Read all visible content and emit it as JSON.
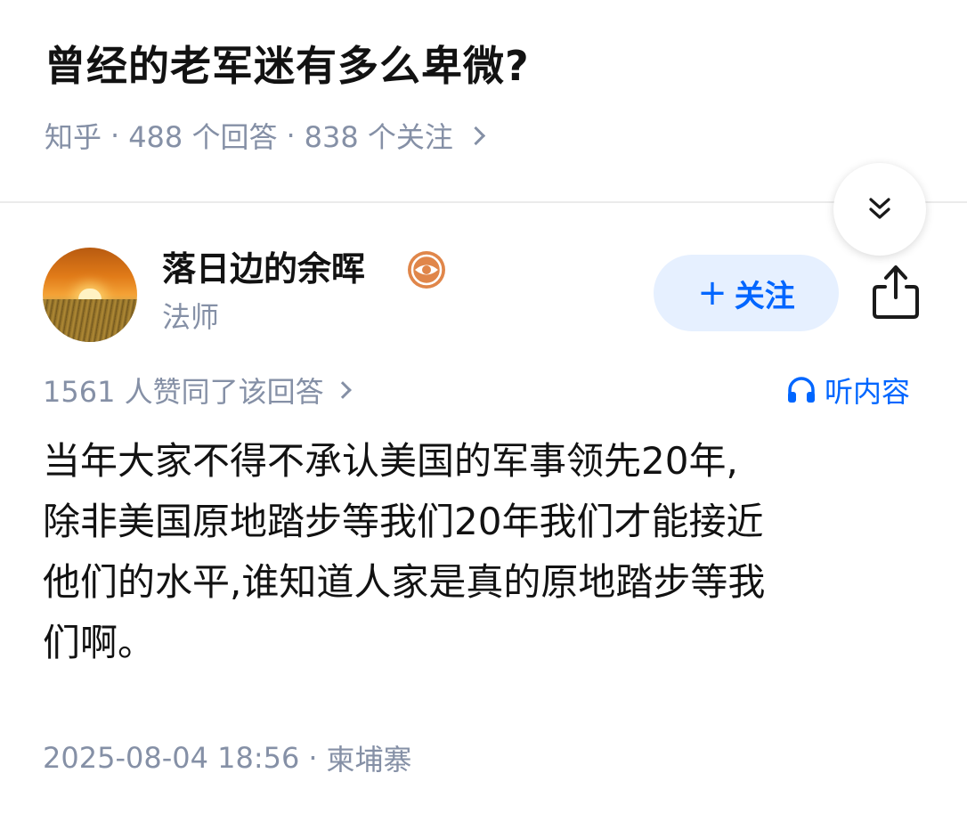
{
  "question": {
    "title": "曾经的老军迷有多么卑微?",
    "source": "知乎",
    "answers_count": "488 个回答",
    "followers_count": "838 个关注"
  },
  "author": {
    "name": "落日边的余晖",
    "title": "法师",
    "follow_label": "关注",
    "badge_icon": "eye-badge-icon"
  },
  "answer": {
    "votes_text": "1561 人赞同了该回答",
    "listen_label": "听内容",
    "lines": [
      "当年大家不得不承认美国的军事领先20年,",
      "除非美国原地踏步等我们20年我们才能接近",
      "他们的水平,谁知道人家是真的原地踏步等我",
      "们啊。"
    ],
    "timestamp": "2025-08-04 18:56",
    "location": "柬埔寨"
  },
  "colors": {
    "accent": "#0066ff",
    "muted": "#8590a6",
    "follow_bg": "#e6f0ff",
    "badge": "#e0864a"
  }
}
